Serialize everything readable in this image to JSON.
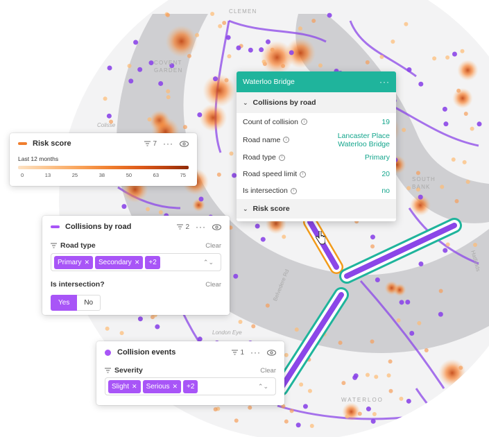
{
  "map": {
    "labels": {
      "top": "CLEMEN",
      "covent_garden_1": "COVENT",
      "covent_garden_2": "GARDEN",
      "south_bank_1": "SOUTH",
      "south_bank_2": "BANK",
      "waterloo": "WATERLOO",
      "colisee": "Colisse",
      "london_eye": "London Eye",
      "belvedere": "Belvedere Rd",
      "hatfields": "Hatfields"
    },
    "colors": {
      "land": "#f3f3f4",
      "water": "#cdcdd0",
      "road_purple": "#8b46e8",
      "highlight_teal": "#1fb49c",
      "highlight_orange": "#f29b1a"
    }
  },
  "popup": {
    "title": "Waterloo Bridge",
    "menu_label": "···",
    "section_collisions": "Collisions by road",
    "rows": [
      {
        "key": "Count of collision",
        "value": "19"
      },
      {
        "key": "Road name",
        "value_line1": "Lancaster Place",
        "value_line2": "Waterloo Bridge"
      },
      {
        "key": "Road type",
        "value": "Primary"
      },
      {
        "key": "Road speed limit",
        "value": "20"
      },
      {
        "key": "Is intersection",
        "value": "no"
      }
    ],
    "section_risk": "Risk score"
  },
  "risk_card": {
    "title": "Risk score",
    "filter_count": "7",
    "period": "Last 12 months",
    "ticks": [
      "0",
      "13",
      "25",
      "38",
      "50",
      "63",
      "75"
    ],
    "legend_color": "#f07e2e"
  },
  "collisions_card": {
    "title": "Collisions by road",
    "filter_count": "2",
    "legend_color": "#a855f7",
    "road_type_label": "Road type",
    "clear_label": "Clear",
    "chips": [
      "Primary",
      "Secondary"
    ],
    "more_chip": "+2",
    "intersection_label": "Is intersection?",
    "clear_label_2": "Clear",
    "yes_label": "Yes",
    "no_label": "No"
  },
  "events_card": {
    "title": "Collision events",
    "filter_count": "1",
    "legend_color": "#a855f7",
    "severity_label": "Severity",
    "clear_label": "Clear",
    "chips": [
      "Slight",
      "Serious"
    ],
    "more_chip": "+2"
  },
  "icons": [
    "filter-icon",
    "more-icon",
    "eye-icon",
    "info-icon",
    "chevron-down-icon",
    "close-icon",
    "caret-icon",
    "hand-cursor-icon"
  ]
}
